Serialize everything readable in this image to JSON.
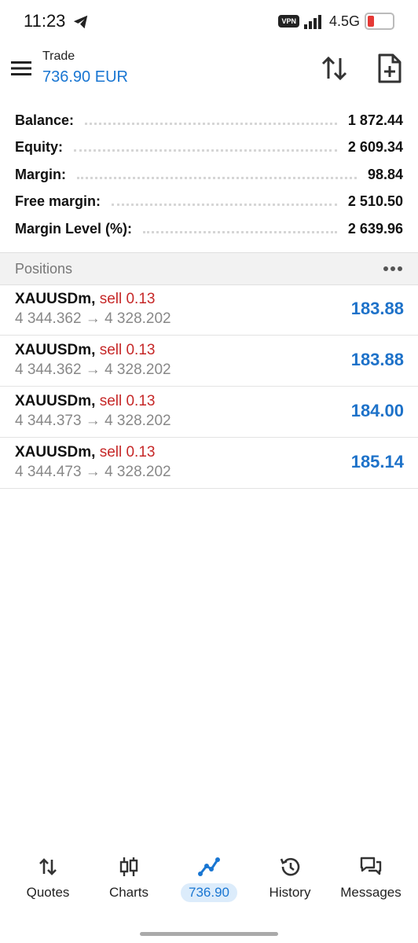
{
  "status_bar": {
    "time": "11:23",
    "vpn": "VPN",
    "network": "4.5G"
  },
  "header": {
    "title": "Trade",
    "subtitle": "736.90 EUR"
  },
  "summary": [
    {
      "label": "Balance:",
      "value": "1 872.44"
    },
    {
      "label": "Equity:",
      "value": "2 609.34"
    },
    {
      "label": "Margin:",
      "value": "98.84"
    },
    {
      "label": "Free margin:",
      "value": "2 510.50"
    },
    {
      "label": "Margin Level (%):",
      "value": "2 639.96"
    }
  ],
  "positions_header": "Positions",
  "positions": [
    {
      "symbol": "XAUUSDm,",
      "side": "sell 0.13",
      "prices": "4 344.362 → 4 328.202",
      "profit": "183.88"
    },
    {
      "symbol": "XAUUSDm,",
      "side": "sell 0.13",
      "prices": "4 344.362 → 4 328.202",
      "profit": "183.88"
    },
    {
      "symbol": "XAUUSDm,",
      "side": "sell 0.13",
      "prices": "4 344.373 → 4 328.202",
      "profit": "184.00"
    },
    {
      "symbol": "XAUUSDm,",
      "side": "sell 0.13",
      "prices": "4 344.473 → 4 328.202",
      "profit": "185.14"
    }
  ],
  "nav": {
    "quotes": "Quotes",
    "charts": "Charts",
    "trade": "736.90",
    "history": "History",
    "messages": "Messages"
  },
  "icons": {
    "menu": "hamburger-icon",
    "sort": "sort-arrows-icon",
    "new_order": "new-document-icon",
    "more": "more-horizontal-icon"
  },
  "colors": {
    "accent": "#1976d2",
    "sell": "#c62828",
    "profit": "#1e72c9",
    "muted": "#888888"
  }
}
